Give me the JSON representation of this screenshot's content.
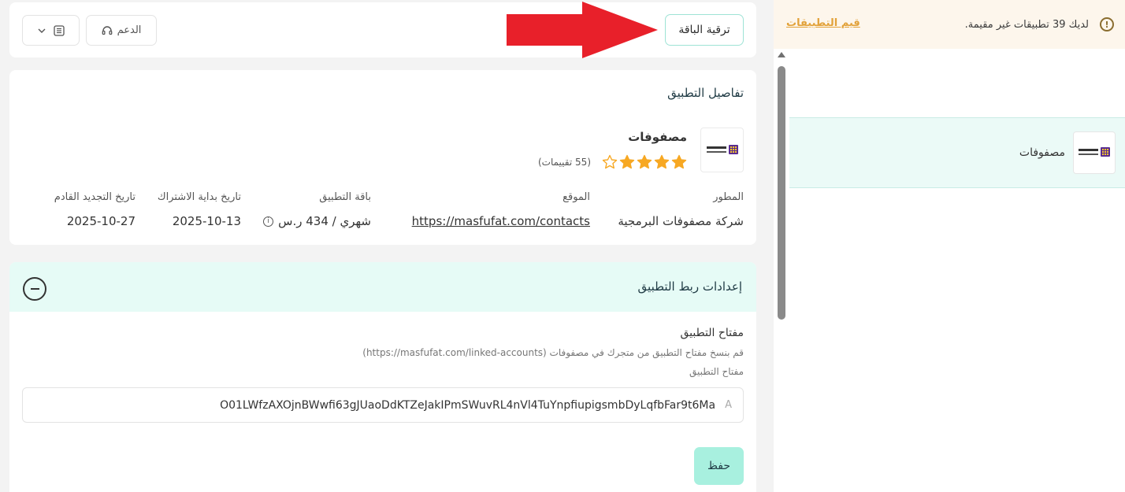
{
  "notice": {
    "text": "لديك 39 تطبيقات غير مقيمة.",
    "link": "قيم التطبيقات"
  },
  "sidebar": {
    "app_label": "مصفوفات"
  },
  "topbar": {
    "upgrade_label": "ترقية الباقة",
    "support_label": "الدعم"
  },
  "details": {
    "title": "تفاصيل التطبيق",
    "app_name": "مصفوفات",
    "reviews": "(55 تقييمات)",
    "rating": 4,
    "rating_max": 5,
    "developer_label": "المطور",
    "developer_value": "شركة مصفوفات البرمجية",
    "website_label": "الموقع",
    "website_value": "https://masfufat.com/contacts",
    "plan_label": "باقة التطبيق",
    "plan_value": "شهري / 434 ر.س",
    "start_label": "تاريخ بداية الاشتراك",
    "start_value": "2025-10-13",
    "renew_label": "تاريخ التجديد القادم",
    "renew_value": "2025-10-27"
  },
  "settings": {
    "title": "إعدادات ربط التطبيق",
    "field_title": "مفتاح التطبيق",
    "hint": "قم بنسخ مفتاح التطبيق من متجرك في مصفوفات (https://masfufat.com/linked-accounts)",
    "field_label": "مفتاح التطبيق",
    "key_value": "O01LWfzAXOjnBWwfi63gJUaoDdKTZeJakIPmSWuvRL4nVl4TuYnpfiupigsmbDyLqfbFar9t6Ma",
    "save_label": "حفظ"
  },
  "colors": {
    "accent": "#a8f0df",
    "star": "#f7a823",
    "link": "#e2a23a",
    "arrow": "#e8202a"
  }
}
